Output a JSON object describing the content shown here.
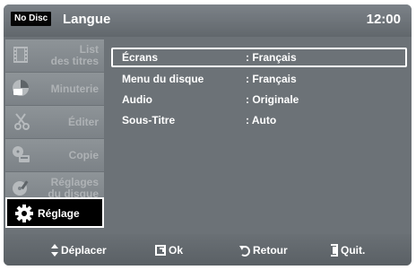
{
  "header": {
    "disc_status": "No Disc",
    "title": "Langue",
    "clock": "12:00"
  },
  "sidebar": {
    "items": [
      {
        "icon": "film-icon",
        "label_lines": [
          "List",
          "des titres"
        ],
        "active": false
      },
      {
        "icon": "timer-icon",
        "label_lines": [
          "Minuterie"
        ],
        "active": false
      },
      {
        "icon": "scissors-icon",
        "label_lines": [
          "Éditer"
        ],
        "active": false
      },
      {
        "icon": "copy-icon",
        "label_lines": [
          "Copie"
        ],
        "active": false
      },
      {
        "icon": "disc-settings-icon",
        "label_lines": [
          "Réglages",
          "du disque"
        ],
        "active": false
      },
      {
        "icon": "gear-icon",
        "label_lines": [
          "Réglage"
        ],
        "active": true
      }
    ]
  },
  "settings": [
    {
      "name": "Écrans",
      "value": ": Français",
      "selected": true
    },
    {
      "name": "Menu du disque",
      "value": ": Français",
      "selected": false
    },
    {
      "name": "Audio",
      "value": ": Originale",
      "selected": false
    },
    {
      "name": "Sous-Titre",
      "value": ": Auto",
      "selected": false
    }
  ],
  "footer": {
    "move": {
      "icon": "up-down-arrows-icon",
      "label": "Déplacer"
    },
    "ok": {
      "icon": "enter-icon",
      "label": "Ok"
    },
    "back": {
      "icon": "return-icon",
      "label": "Retour"
    },
    "quit": {
      "icon": "exit-icon",
      "label": "Quit."
    }
  },
  "colors": {
    "panel": "#6c7277",
    "selection": "#ffffff",
    "active_item": "#000000",
    "inactive_text": "#aeb2b5"
  }
}
